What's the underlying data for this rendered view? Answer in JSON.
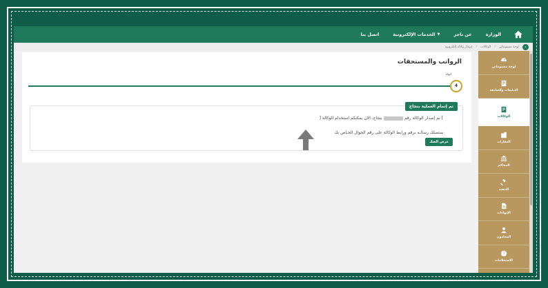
{
  "nav": {
    "items": [
      {
        "label": "الوزارة",
        "name": "nav-ministry"
      },
      {
        "label": "عن ناجز",
        "name": "nav-about-najiz"
      },
      {
        "label": "الخدمات الإلكترونية",
        "name": "nav-eservices",
        "dropdown": true
      },
      {
        "label": "اتصل بنا",
        "name": "nav-contact"
      }
    ],
    "home_icon": "home-icon"
  },
  "breadcrumb": {
    "items": [
      "لوحة مستوماتي",
      "الوكالات",
      "إصدار وكالة إلكترونية"
    ]
  },
  "sidebar": {
    "items": [
      {
        "label": "لوحة مستوماتي",
        "icon": "dashboard-icon"
      },
      {
        "label": "التبليغات والسابقة",
        "icon": "notices-icon"
      },
      {
        "label": "الوكالات",
        "icon": "document-icon",
        "active": true
      },
      {
        "label": "العقارات",
        "icon": "building-icon"
      },
      {
        "label": "المحاكم",
        "icon": "court-icon"
      },
      {
        "label": "التنفيذ",
        "icon": "gavel-icon"
      },
      {
        "label": "الإنهاءات",
        "icon": "file-icon"
      },
      {
        "label": "المحامون",
        "icon": "lawyer-icon"
      },
      {
        "label": "الاستعلامات",
        "icon": "help-icon"
      }
    ]
  },
  "main": {
    "title": "الرواتب والمستحقات",
    "step": {
      "label": "انهاء",
      "number": "4"
    },
    "success": {
      "badge": "تم إتمام العملية بنجاح",
      "msg_prefix": "تم إصدار الوكالة رقم [",
      "msg_suffix": "] بنجاح، الان يمكنكم استخدام الوكالة",
      "msg2": "ستصلك رسالـه برقم ورابط الوكالة على رقم الجوال الخـاص بك",
      "button": "عرض الصك"
    }
  },
  "colors": {
    "primary": "#1e7a5a",
    "gold": "#b99860",
    "frame": "#0f5c48"
  }
}
